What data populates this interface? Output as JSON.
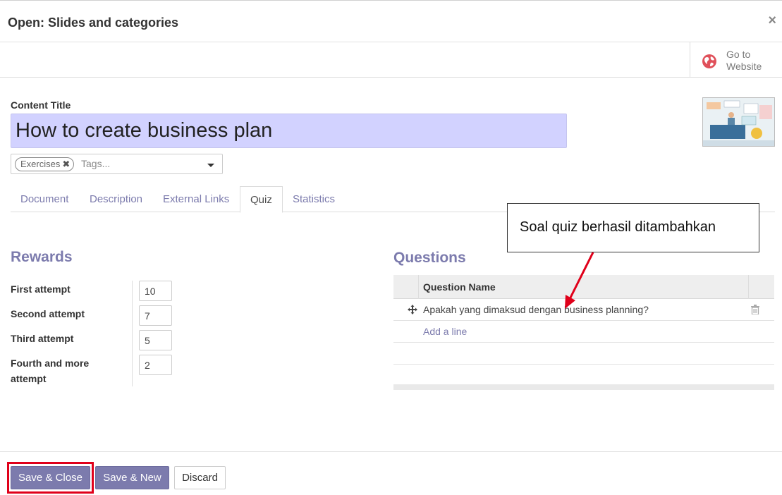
{
  "dialog": {
    "title": "Open: Slides and categories",
    "close_label": "×"
  },
  "button_box": {
    "go_website_line1": "Go to",
    "go_website_line2": "Website",
    "go_website_icon": "globe-icon"
  },
  "form": {
    "content_title_label": "Content Title",
    "content_title_value": "How to create business plan",
    "tags": [
      "Exercises"
    ],
    "tags_placeholder": "Tags..."
  },
  "tabs": [
    {
      "label": "Document",
      "active": false
    },
    {
      "label": "Description",
      "active": false
    },
    {
      "label": "External Links",
      "active": false
    },
    {
      "label": "Quiz",
      "active": true
    },
    {
      "label": "Statistics",
      "active": false
    }
  ],
  "rewards": {
    "title": "Rewards",
    "items": [
      {
        "label": "First attempt",
        "value": "10"
      },
      {
        "label": "Second attempt",
        "value": "7"
      },
      {
        "label": "Third attempt",
        "value": "5"
      },
      {
        "label": "Fourth and more",
        "label2": "attempt",
        "value": "2"
      }
    ]
  },
  "questions": {
    "title": "Questions",
    "column_header": "Question Name",
    "rows": [
      "Apakah yang dimaksud dengan business planning?"
    ],
    "add_line_label": "Add a line"
  },
  "annotation": {
    "callout_text": "Soal quiz berhasil ditambahkan",
    "color": "#e0001a"
  },
  "footer": {
    "save_close_label": "Save & Close",
    "save_new_label": "Save & New",
    "discard_label": "Discard"
  },
  "colors": {
    "accent": "#7c7bad",
    "title_input_bg": "#d2d2ff"
  }
}
